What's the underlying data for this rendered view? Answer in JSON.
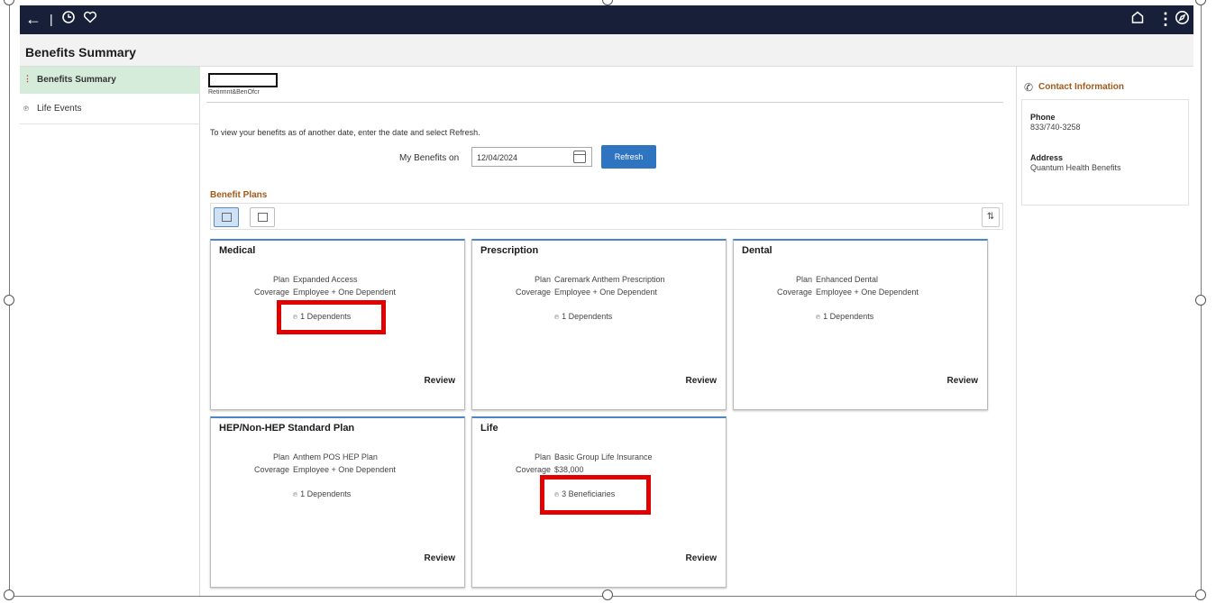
{
  "page": {
    "title": "Benefits Summary"
  },
  "topbar": {
    "back_icon": "arrow-left-icon",
    "history_icon": "clock-icon",
    "favorites_icon": "heart-icon",
    "home_icon": "home-icon",
    "menu_icon": "kebab-menu-icon",
    "navigator_icon": "compass-icon",
    "bg_color": "#172038"
  },
  "sidebar": {
    "items": [
      {
        "label": "Benefits Summary",
        "active": true
      },
      {
        "label": "Life Events",
        "active": false
      }
    ]
  },
  "employee": {
    "department": "Retirmnt&BenOfcr"
  },
  "main": {
    "instructions": "To view your benefits as of another date, enter the date and select Refresh.",
    "date_label": "My Benefits on",
    "date_value": "12/04/2024",
    "refresh_label": "Refresh",
    "section_title": "Benefit Plans"
  },
  "cards": [
    {
      "title": "Medical",
      "plan_label": "Plan",
      "plan": "Expanded Access",
      "coverage_label": "Coverage",
      "coverage": "Employee + One Dependent",
      "link": "1 Dependents",
      "review": "Review"
    },
    {
      "title": "Prescription",
      "plan_label": "Plan",
      "plan": "Caremark Anthem Prescription",
      "coverage_label": "Coverage",
      "coverage": "Employee + One Dependent",
      "link": "1 Dependents",
      "review": "Review"
    },
    {
      "title": "Dental",
      "plan_label": "Plan",
      "plan": "Enhanced Dental",
      "coverage_label": "Coverage",
      "coverage": "Employee + One Dependent",
      "link": "1 Dependents",
      "review": "Review"
    },
    {
      "title": "HEP/Non-HEP Standard Plan",
      "plan_label": "Plan",
      "plan": "Anthem POS HEP Plan",
      "coverage_label": "Coverage",
      "coverage": "Employee + One Dependent",
      "link": "1 Dependents",
      "review": "Review"
    },
    {
      "title": "Life",
      "plan_label": "Plan",
      "plan": "Basic Group Life Insurance",
      "coverage_label": "Coverage",
      "coverage": "$38,000",
      "link": "3 Beneficiaries",
      "review": "Review"
    }
  ],
  "contact": {
    "title": "Contact Information",
    "phone_label": "Phone",
    "phone": "833/740-3258",
    "address_label": "Address",
    "address": "Quantum Health Benefits"
  },
  "colors": {
    "accent": "#2f74c0",
    "section": "#a3591a",
    "highlight": "#e00000",
    "active_nav": "#d5ecdb"
  }
}
